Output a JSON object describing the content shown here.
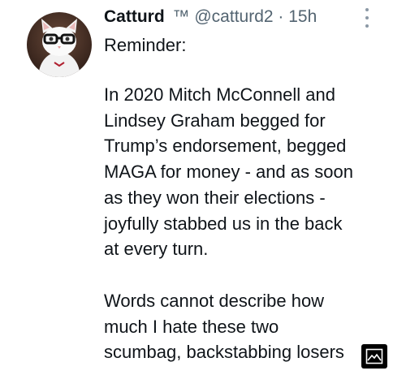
{
  "author": {
    "display_name": "Catturd",
    "trademark": "™",
    "handle": "@catturd2",
    "separator": "·",
    "timestamp": "15h",
    "avatar_icon": "cat-with-glasses-avatar"
  },
  "tweet": {
    "line_intro": "Reminder:",
    "paragraph_1": [
      "In 2020 Mitch McConnell and",
      "Lindsey Graham begged for",
      "Trump’s endorsement, begged",
      "MAGA for money - and as soon",
      "as they won their elections -",
      "joyfully stabbed us in the back",
      "at every turn."
    ],
    "paragraph_2": [
      "Words cannot describe how",
      "much I hate  these two",
      "scumbag, backstabbing losers"
    ]
  },
  "icons": {
    "more": "more-options-icon",
    "media": "image-gallery-icon"
  },
  "colors": {
    "text": "#0f1419",
    "secondary": "#536471",
    "background": "#ffffff"
  }
}
